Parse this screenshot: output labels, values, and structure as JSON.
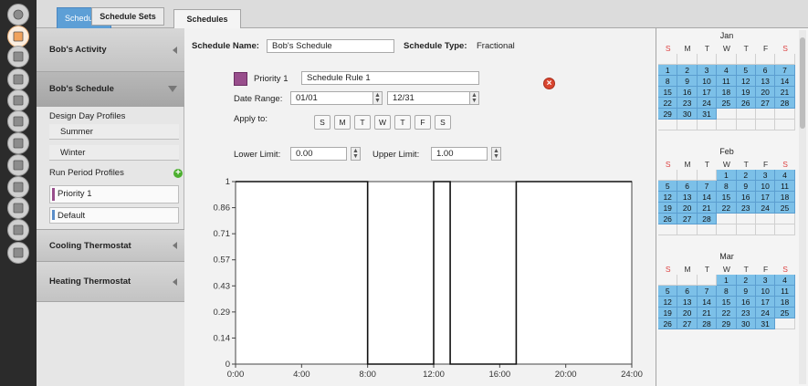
{
  "tabs": {
    "app_tab": "Schedules",
    "sub_tab_1": "Schedule Sets",
    "sub_tab_2": "Schedules"
  },
  "rail_icons": [
    "sphere-icon",
    "schedules-icon",
    "constructions-icon",
    "loads-icon",
    "space-types-icon",
    "geometry-icon",
    "facility-icon",
    "spaces-icon",
    "thermal-zones-icon",
    "hvac-icon",
    "variables-icon",
    "simulation-icon"
  ],
  "schedule_list": {
    "bobs_activity": "Bob's Activity",
    "bobs_schedule": "Bob's Schedule",
    "design_day_profiles": "Design Day Profiles",
    "summer": "Summer",
    "winter": "Winter",
    "run_period_profiles": "Run Period Profiles",
    "priority_1": "Priority 1",
    "default": "Default",
    "cooling_thermostat": "Cooling Thermostat",
    "heating_thermostat": "Heating Thermostat",
    "priority_color": "#984e8c",
    "default_color": "#5b8ec9"
  },
  "schedule": {
    "name_label": "Schedule Name:",
    "name_value": "Bob's Schedule",
    "type_label": "Schedule Type:",
    "type_value": "Fractional",
    "priority_label": "Priority 1",
    "rule_name": "Schedule Rule 1",
    "date_range_label": "Date Range:",
    "date_start": "01/01",
    "date_end": "12/31",
    "apply_to_label": "Apply to:",
    "days": [
      "S",
      "M",
      "T",
      "W",
      "T",
      "F",
      "S"
    ],
    "lower_limit_label": "Lower Limit:",
    "lower_limit_value": "0.00",
    "upper_limit_label": "Upper Limit:",
    "upper_limit_value": "1.00"
  },
  "chart_data": {
    "type": "line",
    "x_ticks": [
      "0:00",
      "4:00",
      "8:00",
      "12:00",
      "16:00",
      "20:00",
      "24:00"
    ],
    "y_ticks": [
      "0",
      "0.14",
      "0.29",
      "0.43",
      "0.57",
      "0.71",
      "0.86",
      "1"
    ],
    "xlim": [
      0,
      24
    ],
    "ylim": [
      0,
      1
    ],
    "series": [
      {
        "x": [
          0,
          8,
          8,
          12,
          12,
          13,
          13,
          17,
          17,
          24
        ],
        "y": [
          1,
          1,
          0,
          0,
          1,
          1,
          0,
          0,
          1,
          1
        ]
      }
    ]
  },
  "calendar": {
    "weekday_headers": [
      "S",
      "M",
      "T",
      "W",
      "T",
      "F",
      "S"
    ],
    "months": [
      {
        "name": "Jan",
        "weeks": [
          [
            "",
            "",
            "",
            "",
            "",
            "",
            ""
          ],
          [
            "1",
            "2",
            "3",
            "4",
            "5",
            "6",
            "7"
          ],
          [
            "8",
            "9",
            "10",
            "11",
            "12",
            "13",
            "14"
          ],
          [
            "15",
            "16",
            "17",
            "18",
            "19",
            "20",
            "21"
          ],
          [
            "22",
            "23",
            "24",
            "25",
            "26",
            "27",
            "28"
          ],
          [
            "29",
            "30",
            "31",
            "",
            "",
            "",
            ""
          ],
          [
            "",
            "",
            "",
            "",
            "",
            "",
            ""
          ]
        ]
      },
      {
        "name": "Feb",
        "weeks": [
          [
            "",
            "",
            "",
            "1",
            "2",
            "3",
            "4"
          ],
          [
            "5",
            "6",
            "7",
            "8",
            "9",
            "10",
            "11"
          ],
          [
            "12",
            "13",
            "14",
            "15",
            "16",
            "17",
            "18"
          ],
          [
            "19",
            "20",
            "21",
            "22",
            "23",
            "24",
            "25"
          ],
          [
            "26",
            "27",
            "28",
            "",
            "",
            "",
            ""
          ],
          [
            "",
            "",
            "",
            "",
            "",
            "",
            ""
          ]
        ]
      },
      {
        "name": "Mar",
        "weeks": [
          [
            "",
            "",
            "",
            "1",
            "2",
            "3",
            "4"
          ],
          [
            "5",
            "6",
            "7",
            "8",
            "9",
            "10",
            "11"
          ],
          [
            "12",
            "13",
            "14",
            "15",
            "16",
            "17",
            "18"
          ],
          [
            "19",
            "20",
            "21",
            "22",
            "23",
            "24",
            "25"
          ],
          [
            "26",
            "27",
            "28",
            "29",
            "30",
            "31",
            ""
          ]
        ]
      }
    ]
  }
}
